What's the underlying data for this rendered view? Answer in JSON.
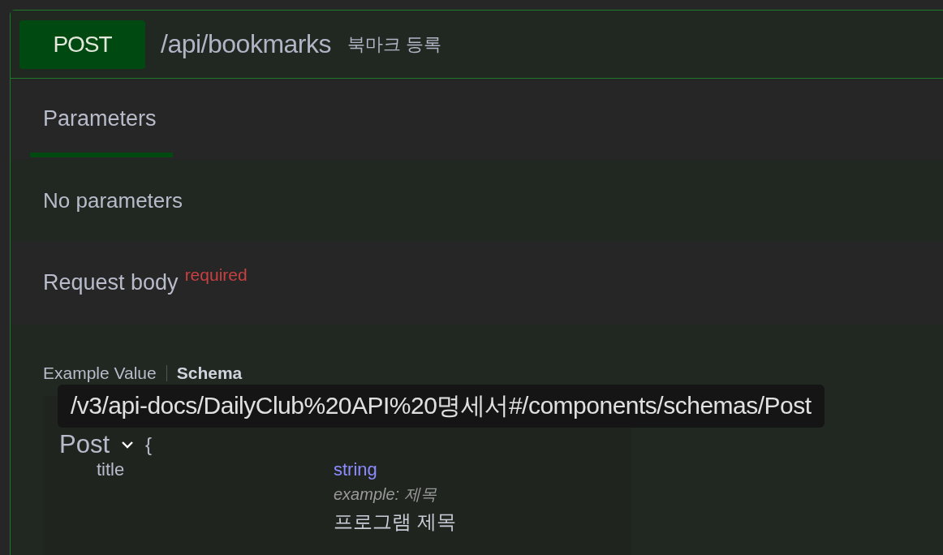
{
  "operation": {
    "method": "POST",
    "path": "/api/bookmarks",
    "summary": "북마크 등록"
  },
  "tabs": [
    {
      "label": "Parameters",
      "selected": true
    }
  ],
  "parameters": {
    "message": "No parameters"
  },
  "request_body": {
    "title": "Request body",
    "required": "required"
  },
  "body_tabs": [
    {
      "label": "Example Value",
      "selected": false
    },
    {
      "label": "Schema",
      "selected": true
    }
  ],
  "tooltip": "/v3/api-docs/DailyClub%20API%20명세서#/components/schemas/Post",
  "model": {
    "name": "Post",
    "expanded": true,
    "brace": "{",
    "properties": [
      {
        "name": "title",
        "type": "string",
        "example": "example: 제목",
        "description": "프로그램 제목"
      }
    ]
  }
}
